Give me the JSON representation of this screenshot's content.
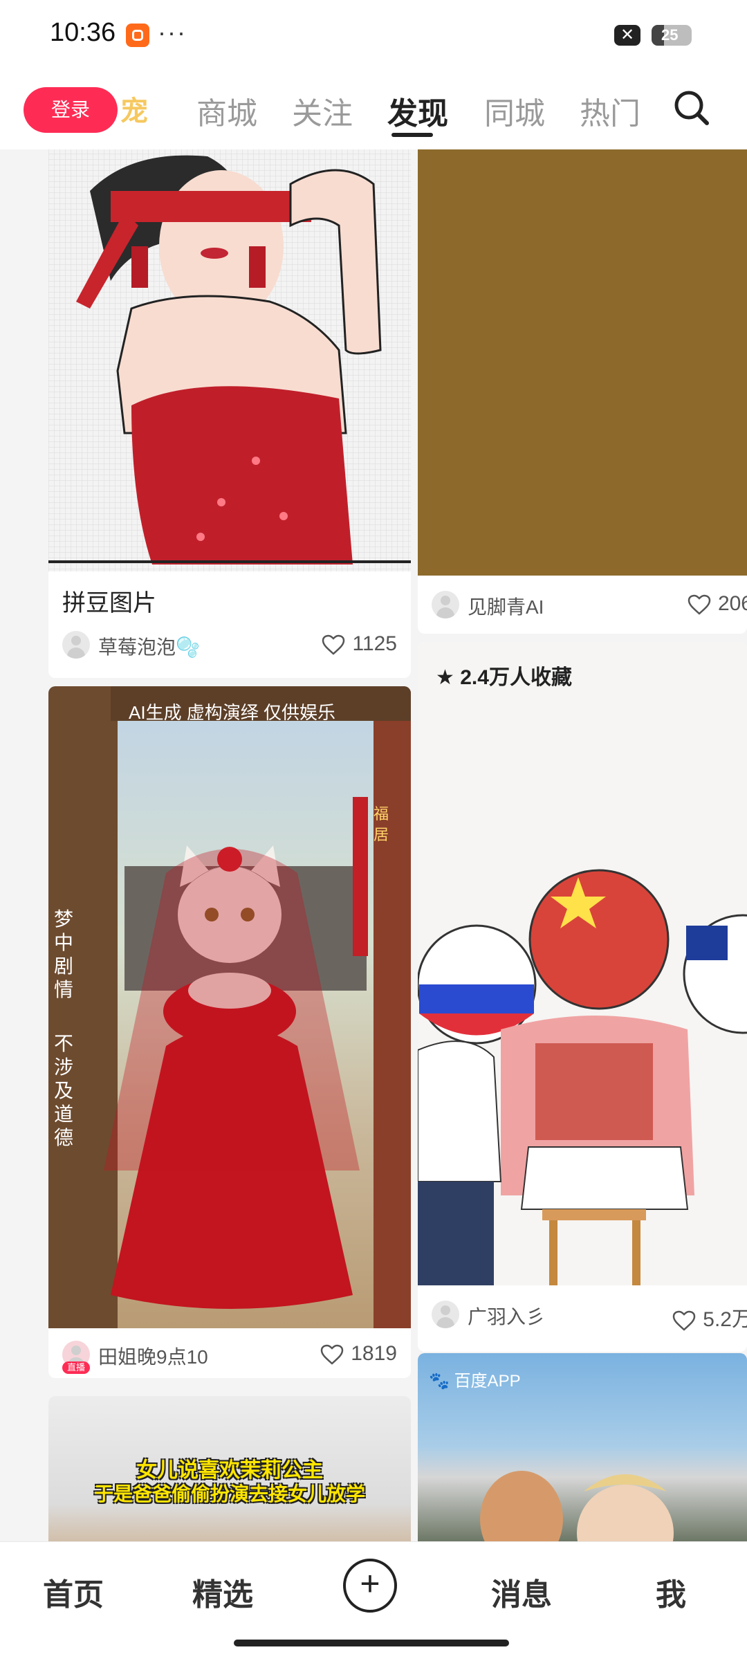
{
  "status_bar": {
    "time": "10:36",
    "dots": "···",
    "battery": "25"
  },
  "top_nav": {
    "login": "登录",
    "cut_tab": "宠",
    "tabs": [
      "商城",
      "关注",
      "发现",
      "同城",
      "热门"
    ],
    "active_tab": "发现"
  },
  "cards": {
    "c1": {
      "title": "拼豆图片",
      "author": "草莓泡泡🫧",
      "likes": "1125"
    },
    "c2": {
      "author": "见脚青AI",
      "likes": "206"
    },
    "c3": {
      "badge": "2.4万人收藏",
      "author": "广羽入彡",
      "likes": "5.2万"
    },
    "c4": {
      "caption_top": "AI生成 虚构演绎 仅供娱乐",
      "side_left": "梦中剧情",
      "side_left2": "不涉及道德",
      "side_right": "福居",
      "author": "田姐晚9点10",
      "live": "直播",
      "likes": "1819"
    },
    "c5": {
      "source": "百度APP"
    },
    "c6": {
      "line1": "女儿说喜欢茉莉公主",
      "line2": "于是爸爸偷偷扮演去接女儿放学"
    }
  },
  "bottom_nav": {
    "home": "首页",
    "featured": "精选",
    "plus": "+",
    "messages": "消息",
    "me": "我"
  },
  "colors": {
    "accent": "#fe2c55",
    "bg": "#f4f4f4"
  },
  "icons": [
    "search-icon",
    "heart-icon",
    "star-icon",
    "plus-icon",
    "close-icon",
    "battery-icon"
  ]
}
